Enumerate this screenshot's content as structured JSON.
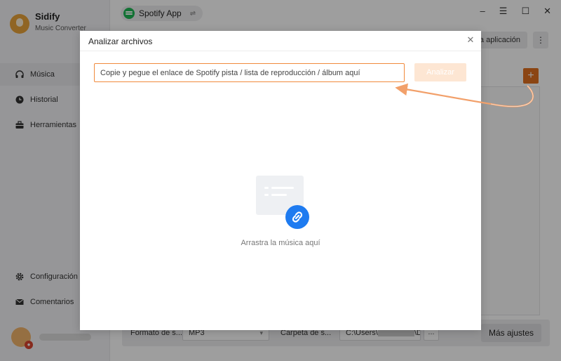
{
  "app": {
    "name": "Sidify",
    "subtitle": "Music Converter",
    "source": "Spotify App",
    "accent_color": "#e0701f"
  },
  "sidebar": {
    "items": [
      {
        "label": "Música",
        "icon": "headphones-icon"
      },
      {
        "label": "Historial",
        "icon": "clock-icon"
      },
      {
        "label": "Herramientas",
        "icon": "toolbox-icon"
      }
    ],
    "bottom_items": [
      {
        "label": "Configuración",
        "icon": "gear-icon"
      },
      {
        "label": "Comentarios",
        "icon": "mail-icon"
      }
    ]
  },
  "window": {
    "minimize": "–",
    "menu": "☰",
    "maximize": "☐",
    "close": "✕"
  },
  "toolbar": {
    "load_app_label": "r la aplicación",
    "more_label": "⋮",
    "add_label": "+"
  },
  "settings_bar": {
    "format_label": "Formato de s...",
    "format_value": "MP3",
    "folder_label": "Carpeta de s...",
    "folder_value": "C:\\Users\\",
    "folder_tail": "\\D",
    "browse_label": "...",
    "more_settings_label": "Más ajustes"
  },
  "dialog": {
    "title": "Analizar archivos",
    "close_label": "✕",
    "input_placeholder": "Copie y pegue el enlace de Spotify pista / lista de reproducción / álbum aquí",
    "analyze_label": "Analizar",
    "drop_label": "Arrastra la música aquí"
  }
}
